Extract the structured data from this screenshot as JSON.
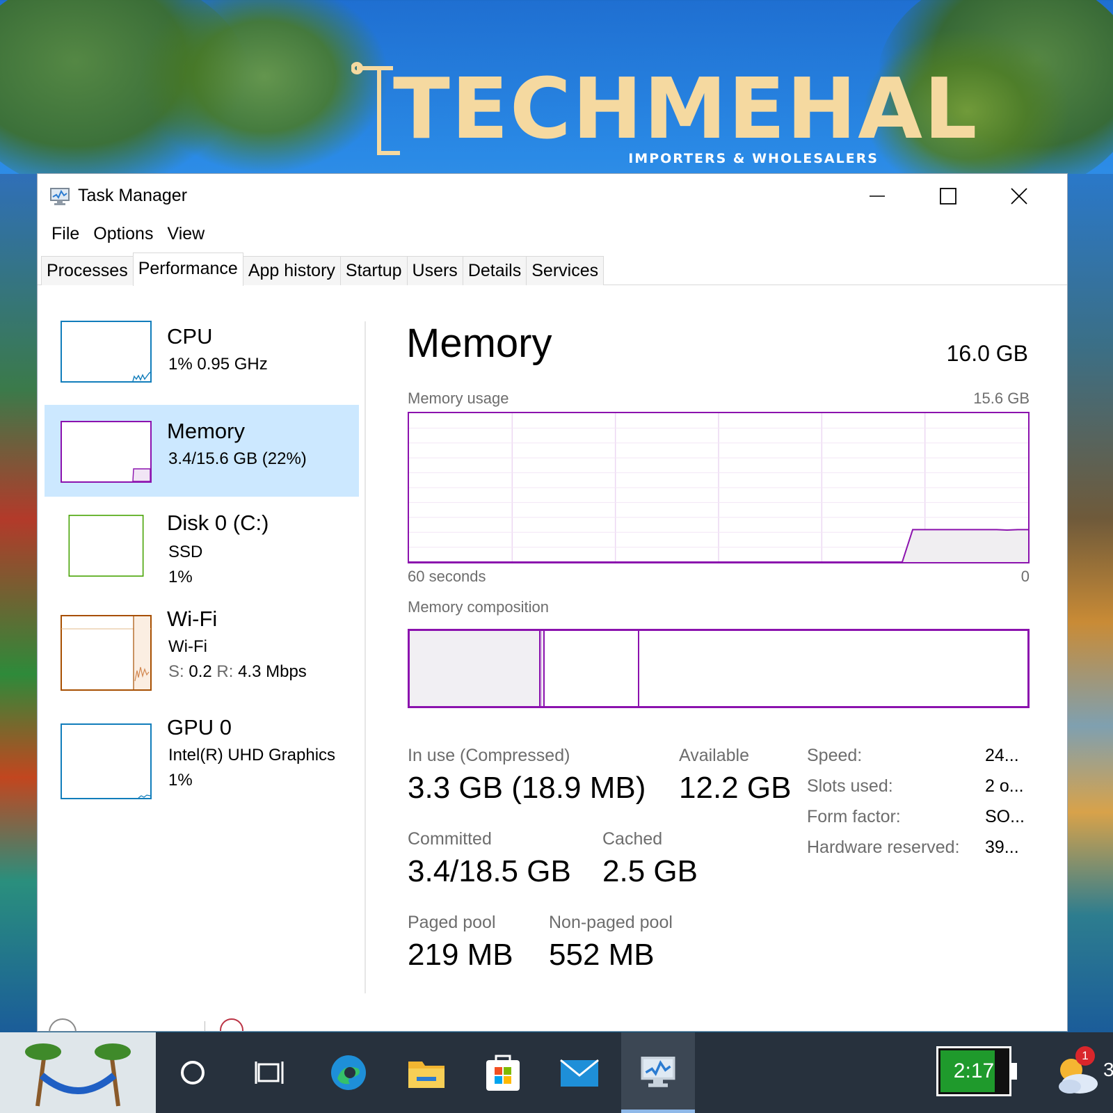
{
  "wallpaper": {
    "logo_text": "TECHMEHAL",
    "logo_subtitle": "IMPORTERS & WHOLESALERS"
  },
  "window": {
    "title": "Task Manager",
    "app_icon": "task-manager-icon",
    "controls": [
      "minimize-icon",
      "maximize-icon",
      "close-icon"
    ]
  },
  "menu": {
    "file": "File",
    "options": "Options",
    "view": "View"
  },
  "tabs": [
    {
      "label": "Processes",
      "active": false
    },
    {
      "label": "Performance",
      "active": true
    },
    {
      "label": "App history",
      "active": false
    },
    {
      "label": "Startup",
      "active": false
    },
    {
      "label": "Users",
      "active": false
    },
    {
      "label": "Details",
      "active": false
    },
    {
      "label": "Services",
      "active": false
    }
  ],
  "sidebar": {
    "cpu": {
      "title": "CPU",
      "line1": "1%  0.95 GHz",
      "color": "#117dbb"
    },
    "memory": {
      "title": "Memory",
      "line1": "3.4/15.6 GB (22%)",
      "color": "#8b12ae",
      "selected": true
    },
    "disk": {
      "title": "Disk 0 (C:)",
      "line1": "SSD",
      "line2": "1%",
      "color": "#4da60c"
    },
    "wifi": {
      "title": "Wi-Fi",
      "line1": "Wi-Fi",
      "send_label": "S:",
      "send_value": "0.2",
      "recv_label": "R:",
      "recv_value": "4.3 Mbps",
      "color": "#a74f01"
    },
    "gpu": {
      "title": "GPU 0",
      "line1": "Intel(R) UHD Graphics",
      "line2": "1%",
      "color": "#117dbb"
    }
  },
  "main": {
    "title": "Memory",
    "total": "16.0 GB",
    "usage_label": "Memory usage",
    "usage_max": "15.6 GB",
    "time_left": "60 seconds",
    "time_right": "0",
    "composition_label": "Memory composition",
    "accent": "#8b12ae"
  },
  "stats": {
    "in_use_label": "In use (Compressed)",
    "in_use_value": "3.3 GB (18.9 MB)",
    "available_label": "Available",
    "available_value": "12.2 GB",
    "committed_label": "Committed",
    "committed_value": "3.4/18.5 GB",
    "cached_label": "Cached",
    "cached_value": "2.5 GB",
    "paged_label": "Paged pool",
    "paged_value": "219 MB",
    "nonpaged_label": "Non-paged pool",
    "nonpaged_value": "552 MB"
  },
  "specs": [
    {
      "label": "Speed:",
      "value": "24..."
    },
    {
      "label": "Slots used:",
      "value": "2 o..."
    },
    {
      "label": "Form factor:",
      "value": "SO..."
    },
    {
      "label": "Hardware reserved:",
      "value": "39..."
    }
  ],
  "taskbar": {
    "clock": "2:17",
    "notification_count": "1",
    "edge_text": "3",
    "icons": [
      "start-wallpaper-icon",
      "search-circle-icon",
      "task-view-icon",
      "edge-icon",
      "file-explorer-icon",
      "store-icon",
      "mail-icon",
      "task-manager-icon"
    ]
  },
  "chart_data": {
    "type": "area",
    "title": "Memory usage",
    "xlabel": "60 seconds",
    "ylabel": "",
    "x_range": [
      60,
      0
    ],
    "ylim": [
      0,
      15.6
    ],
    "series": [
      {
        "name": "",
        "values": [
          0,
          0,
          0,
          0,
          0,
          0,
          0,
          0,
          0,
          0,
          0,
          0,
          0,
          0,
          0,
          0,
          0,
          0,
          0,
          0,
          0,
          0,
          0,
          0,
          0,
          0,
          0,
          0,
          0,
          0,
          0,
          0,
          0,
          0,
          0,
          0,
          0,
          0,
          0,
          0,
          0,
          0,
          0,
          0,
          0,
          0,
          0,
          0,
          3.4,
          3.4,
          3.4,
          3.4,
          3.4,
          3.4,
          3.4,
          3.4,
          3.4,
          3.35,
          3.4,
          3.4
        ]
      }
    ],
    "composition": {
      "total_gb": 15.6,
      "segments": [
        {
          "name": "in_use",
          "value": 3.3
        },
        {
          "name": "modified",
          "value": 0.1
        },
        {
          "name": "standby",
          "value": 2.4
        },
        {
          "name": "free",
          "value": 9.8
        }
      ]
    }
  }
}
